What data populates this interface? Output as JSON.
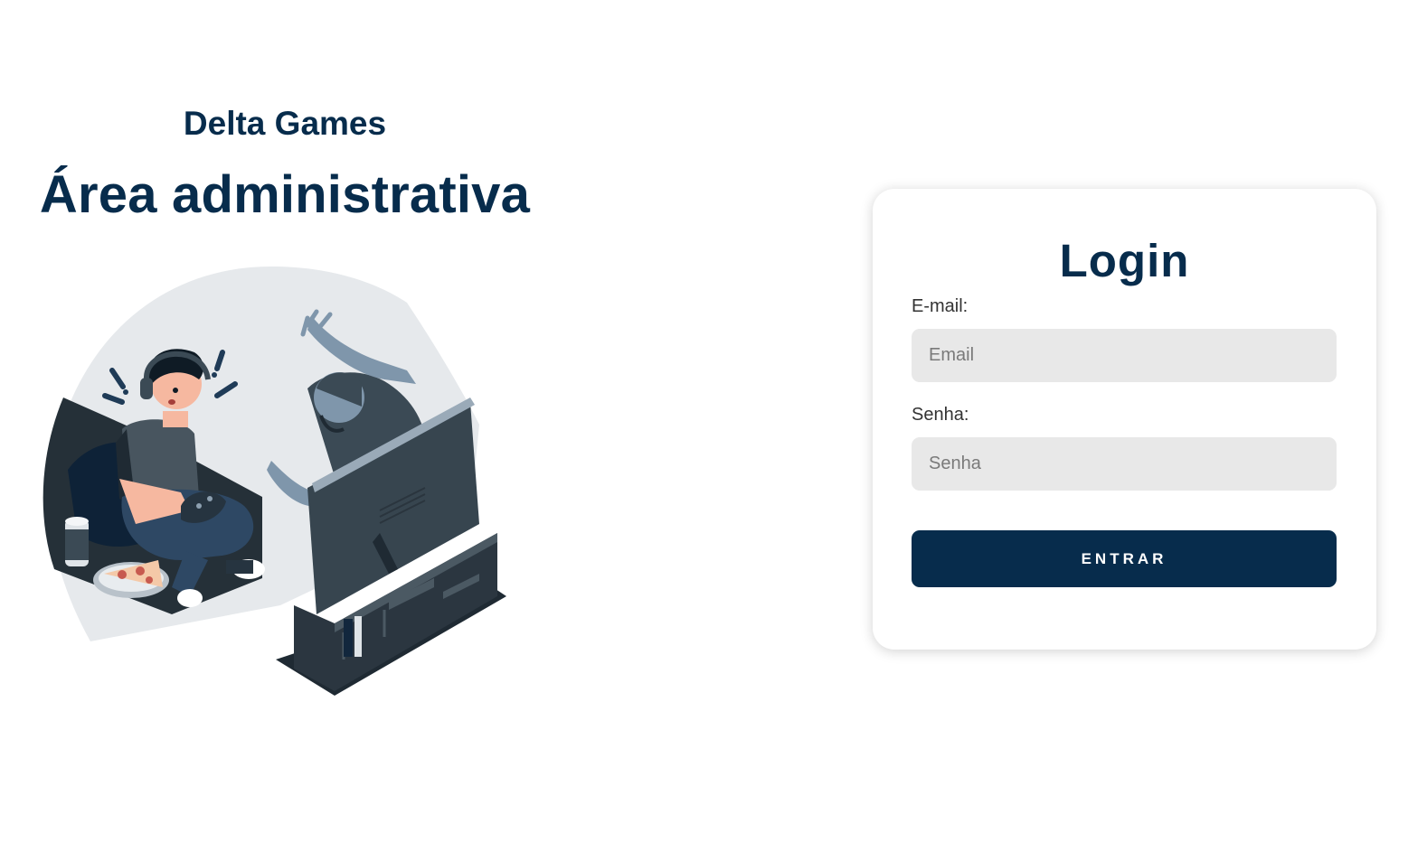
{
  "hero": {
    "brand": "Delta Games",
    "headline": "Área administrativa",
    "illustration": "gamer-scared-by-monster-from-tv"
  },
  "login": {
    "title": "Login",
    "email_label": "E-mail:",
    "email_placeholder": "Email",
    "password_label": "Senha:",
    "password_placeholder": "Senha",
    "submit_label": "ENTRAR"
  },
  "colors": {
    "brand": "#072c4c",
    "input_bg": "#e8e8e8",
    "page_bg": "#ffffff"
  }
}
